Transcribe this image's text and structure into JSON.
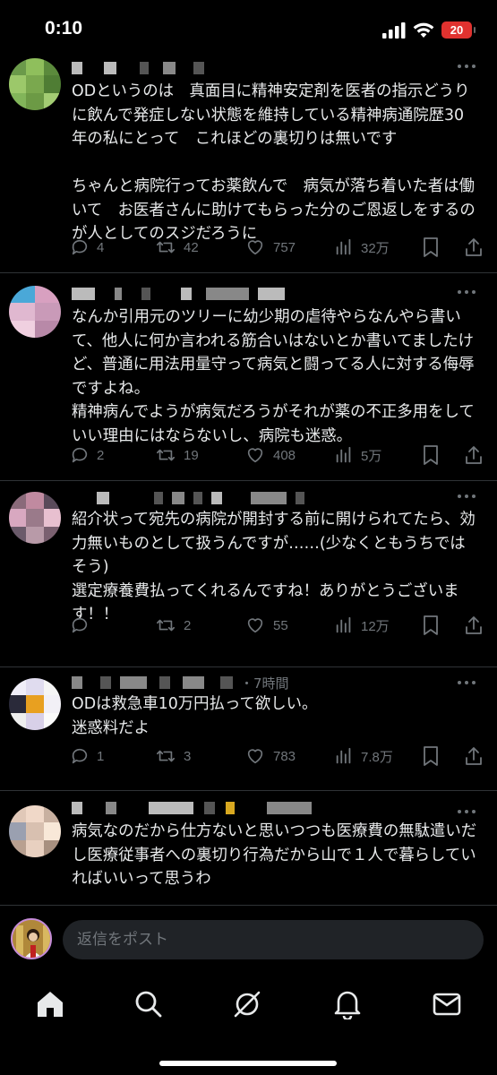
{
  "status_bar": {
    "time": "0:10",
    "battery": "20"
  },
  "replies": [
    {
      "time": "",
      "text": "ODというのは　真面目に精神安定剤を医者の指示どうりに飲んで発症しない状態を維持している精神病通院歴30年の私にとって　これほどの裏切りは無いです\n\nちゃんと病院行ってお薬飲んで　病気が落ち着いた者は働いて　お医者さんに助けてもらった分のご恩返しをするのが人としてのスジだろうに",
      "reply_count": "4",
      "retweet_count": "42",
      "like_count": "757",
      "view_count": "32万"
    },
    {
      "time": "",
      "text": "なんか引用元のツリーに幼少期の虐待やらなんやら書いて、他人に何か言われる筋合いはないとか書いてましたけど、普通に用法用量守って病気と闘ってる人に対する侮辱ですよね。\n精神病んでようが病気だろうがそれが薬の不正多用をしていい理由にはならないし、病院も迷惑。",
      "reply_count": "2",
      "retweet_count": "19",
      "like_count": "408",
      "view_count": "5万"
    },
    {
      "time": "",
      "text": "紹介状って宛先の病院が開封する前に開けられてたら、効力無いものとして扱うんですが……(少なくともうちではそう)\n選定療養費払ってくれるんですね！ありがとうございます！！",
      "reply_count": "",
      "retweet_count": "2",
      "like_count": "55",
      "view_count": "12万"
    },
    {
      "time": "・7時間",
      "text": "ODは救急車10万円払って欲しい。\n迷惑料だよ",
      "reply_count": "1",
      "retweet_count": "3",
      "like_count": "783",
      "view_count": "7.8万"
    },
    {
      "time": "",
      "text": "病気なのだから仕方ないと思いつつも医療費の無駄遣いだし医療従事者への裏切り行為だから山で１人で暮らしていればいいって思うわ"
    }
  ],
  "compose": {
    "placeholder": "返信をポスト"
  },
  "tabbar": [
    "home-icon",
    "search-icon",
    "grok-icon",
    "notifications-icon",
    "messages-icon"
  ],
  "colors": {
    "background": "#000000",
    "text": "#e7e9ea",
    "muted": "#71767b",
    "battery": "#e0322f"
  }
}
